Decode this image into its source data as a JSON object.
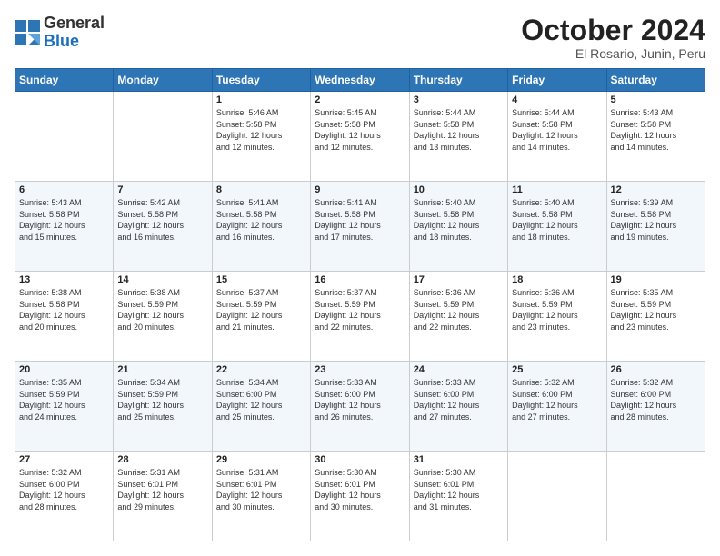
{
  "logo": {
    "general": "General",
    "blue": "Blue"
  },
  "title": "October 2024",
  "subtitle": "El Rosario, Junin, Peru",
  "days_header": [
    "Sunday",
    "Monday",
    "Tuesday",
    "Wednesday",
    "Thursday",
    "Friday",
    "Saturday"
  ],
  "weeks": [
    [
      {
        "day": "",
        "info": ""
      },
      {
        "day": "",
        "info": ""
      },
      {
        "day": "1",
        "info": "Sunrise: 5:46 AM\nSunset: 5:58 PM\nDaylight: 12 hours\nand 12 minutes."
      },
      {
        "day": "2",
        "info": "Sunrise: 5:45 AM\nSunset: 5:58 PM\nDaylight: 12 hours\nand 12 minutes."
      },
      {
        "day": "3",
        "info": "Sunrise: 5:44 AM\nSunset: 5:58 PM\nDaylight: 12 hours\nand 13 minutes."
      },
      {
        "day": "4",
        "info": "Sunrise: 5:44 AM\nSunset: 5:58 PM\nDaylight: 12 hours\nand 14 minutes."
      },
      {
        "day": "5",
        "info": "Sunrise: 5:43 AM\nSunset: 5:58 PM\nDaylight: 12 hours\nand 14 minutes."
      }
    ],
    [
      {
        "day": "6",
        "info": "Sunrise: 5:43 AM\nSunset: 5:58 PM\nDaylight: 12 hours\nand 15 minutes."
      },
      {
        "day": "7",
        "info": "Sunrise: 5:42 AM\nSunset: 5:58 PM\nDaylight: 12 hours\nand 16 minutes."
      },
      {
        "day": "8",
        "info": "Sunrise: 5:41 AM\nSunset: 5:58 PM\nDaylight: 12 hours\nand 16 minutes."
      },
      {
        "day": "9",
        "info": "Sunrise: 5:41 AM\nSunset: 5:58 PM\nDaylight: 12 hours\nand 17 minutes."
      },
      {
        "day": "10",
        "info": "Sunrise: 5:40 AM\nSunset: 5:58 PM\nDaylight: 12 hours\nand 18 minutes."
      },
      {
        "day": "11",
        "info": "Sunrise: 5:40 AM\nSunset: 5:58 PM\nDaylight: 12 hours\nand 18 minutes."
      },
      {
        "day": "12",
        "info": "Sunrise: 5:39 AM\nSunset: 5:58 PM\nDaylight: 12 hours\nand 19 minutes."
      }
    ],
    [
      {
        "day": "13",
        "info": "Sunrise: 5:38 AM\nSunset: 5:58 PM\nDaylight: 12 hours\nand 20 minutes."
      },
      {
        "day": "14",
        "info": "Sunrise: 5:38 AM\nSunset: 5:59 PM\nDaylight: 12 hours\nand 20 minutes."
      },
      {
        "day": "15",
        "info": "Sunrise: 5:37 AM\nSunset: 5:59 PM\nDaylight: 12 hours\nand 21 minutes."
      },
      {
        "day": "16",
        "info": "Sunrise: 5:37 AM\nSunset: 5:59 PM\nDaylight: 12 hours\nand 22 minutes."
      },
      {
        "day": "17",
        "info": "Sunrise: 5:36 AM\nSunset: 5:59 PM\nDaylight: 12 hours\nand 22 minutes."
      },
      {
        "day": "18",
        "info": "Sunrise: 5:36 AM\nSunset: 5:59 PM\nDaylight: 12 hours\nand 23 minutes."
      },
      {
        "day": "19",
        "info": "Sunrise: 5:35 AM\nSunset: 5:59 PM\nDaylight: 12 hours\nand 23 minutes."
      }
    ],
    [
      {
        "day": "20",
        "info": "Sunrise: 5:35 AM\nSunset: 5:59 PM\nDaylight: 12 hours\nand 24 minutes."
      },
      {
        "day": "21",
        "info": "Sunrise: 5:34 AM\nSunset: 5:59 PM\nDaylight: 12 hours\nand 25 minutes."
      },
      {
        "day": "22",
        "info": "Sunrise: 5:34 AM\nSunset: 6:00 PM\nDaylight: 12 hours\nand 25 minutes."
      },
      {
        "day": "23",
        "info": "Sunrise: 5:33 AM\nSunset: 6:00 PM\nDaylight: 12 hours\nand 26 minutes."
      },
      {
        "day": "24",
        "info": "Sunrise: 5:33 AM\nSunset: 6:00 PM\nDaylight: 12 hours\nand 27 minutes."
      },
      {
        "day": "25",
        "info": "Sunrise: 5:32 AM\nSunset: 6:00 PM\nDaylight: 12 hours\nand 27 minutes."
      },
      {
        "day": "26",
        "info": "Sunrise: 5:32 AM\nSunset: 6:00 PM\nDaylight: 12 hours\nand 28 minutes."
      }
    ],
    [
      {
        "day": "27",
        "info": "Sunrise: 5:32 AM\nSunset: 6:00 PM\nDaylight: 12 hours\nand 28 minutes."
      },
      {
        "day": "28",
        "info": "Sunrise: 5:31 AM\nSunset: 6:01 PM\nDaylight: 12 hours\nand 29 minutes."
      },
      {
        "day": "29",
        "info": "Sunrise: 5:31 AM\nSunset: 6:01 PM\nDaylight: 12 hours\nand 30 minutes."
      },
      {
        "day": "30",
        "info": "Sunrise: 5:30 AM\nSunset: 6:01 PM\nDaylight: 12 hours\nand 30 minutes."
      },
      {
        "day": "31",
        "info": "Sunrise: 5:30 AM\nSunset: 6:01 PM\nDaylight: 12 hours\nand 31 minutes."
      },
      {
        "day": "",
        "info": ""
      },
      {
        "day": "",
        "info": ""
      }
    ]
  ]
}
